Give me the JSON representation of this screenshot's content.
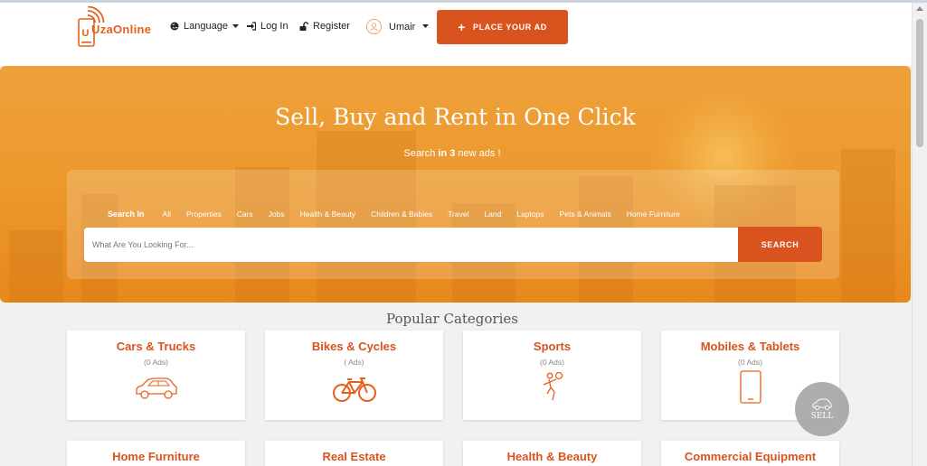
{
  "brand": {
    "name": "UzaOnline",
    "logo_letter": "U",
    "accent": "#d9531e"
  },
  "nav": {
    "language": "Language",
    "login": "Log In",
    "register": "Register",
    "user": "Umair",
    "place_ad": "PLACE YOUR AD"
  },
  "hero": {
    "title": "Sell, Buy and Rent in One Click",
    "sub_prefix": "Search",
    "sub_bold": "in 3",
    "sub_suffix": "new ads !",
    "search_label": "Search In",
    "tabs": [
      "All",
      "Properties",
      "Cars",
      "Jobs",
      "Health & Beauty",
      "Children & Babies",
      "Travel",
      "Land",
      "Laptops",
      "Pets & Animals",
      "Home Furniture"
    ],
    "search_placeholder": "What Are You Looking For...",
    "search_button": "SEARCH"
  },
  "categories": {
    "title": "Popular Categories",
    "items": [
      {
        "name": "Cars & Trucks",
        "count": "(0 Ads)",
        "icon": "car-icon"
      },
      {
        "name": "Bikes & Cycles",
        "count": "( Ads)",
        "icon": "bicycle-icon"
      },
      {
        "name": "Sports",
        "count": "(0 Ads)",
        "icon": "sports-icon"
      },
      {
        "name": "Mobiles & Tablets",
        "count": "(0 Ads)",
        "icon": "tablet-icon"
      },
      {
        "name": "Home Furniture"
      },
      {
        "name": "Real Estate"
      },
      {
        "name": "Health & Beauty"
      },
      {
        "name": "Commercial Equipment"
      }
    ]
  },
  "sell_button": "SELL"
}
